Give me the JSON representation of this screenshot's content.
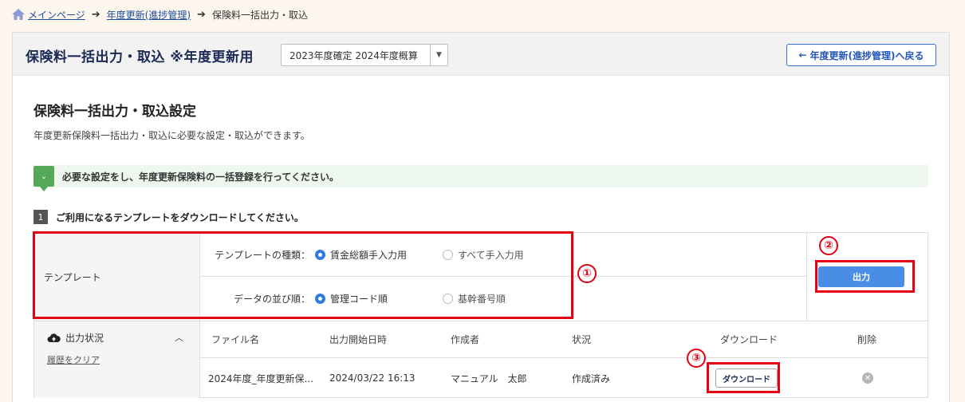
{
  "breadcrumb": {
    "home": "メインページ",
    "middle": "年度更新(進捗管理)",
    "current": "保険料一括出力・取込"
  },
  "header": {
    "title": "保険料一括出力・取込 ※年度更新用",
    "year_select": "2023年度確定 2024年度概算",
    "back_button": "年度更新(進捗管理)へ戻る"
  },
  "section": {
    "title": "保険料一括出力・取込設定",
    "desc": "年度更新保険料一括出力・取込に必要な設定・取込ができます。"
  },
  "notice": "必要な設定をし、年度更新保険料の一括登録を行ってください。",
  "step": {
    "num": "1",
    "text": "ご利用になるテンプレートをダウンロードしてください。"
  },
  "template": {
    "label": "テンプレート",
    "type_label": "テンプレートの種類：",
    "type_opt1": "賃金総額手入力用",
    "type_opt2": "すべて手入力用",
    "order_label": "データの並び順：",
    "order_opt1": "管理コード順",
    "order_opt2": "基幹番号順",
    "output_button": "出力"
  },
  "status": {
    "title": "出力状況",
    "clear": "履歴をクリア",
    "headers": {
      "file": "ファイル名",
      "started": "出力開始日時",
      "author": "作成者",
      "state": "状況",
      "download": "ダウンロード",
      "delete": "削除"
    },
    "row": {
      "file": "2024年度_年度更新保...",
      "started": "2024/03/22 16:13",
      "author": "マニュアル　太郎",
      "state": "作成済み",
      "download": "ダウンロード"
    }
  },
  "annotations": {
    "a1": "①",
    "a2": "②",
    "a3": "③"
  },
  "colors": {
    "accent": "#2f7be0",
    "highlight": "#e60012",
    "title": "#1a2a55"
  }
}
